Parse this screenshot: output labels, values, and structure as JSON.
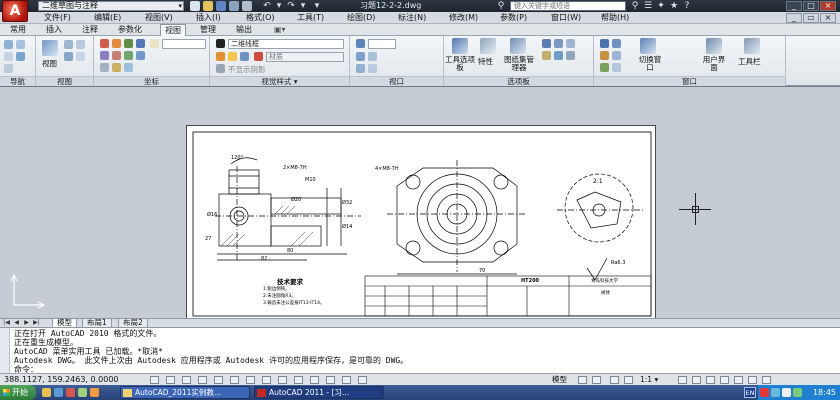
{
  "app": {
    "logo_letter": "A",
    "workspace": "二维草图与注释",
    "title": "习题12-2-2.dwg",
    "search_placeholder": "键入关键字或短语"
  },
  "menu": [
    "文件(F)",
    "编辑(E)",
    "视图(V)",
    "插入(I)",
    "格式(O)",
    "工具(T)",
    "绘图(D)",
    "标注(N)",
    "修改(M)",
    "参数(P)",
    "窗口(W)",
    "帮助(H)"
  ],
  "tabs": [
    "常用",
    "插入",
    "注释",
    "参数化",
    "视图",
    "管理",
    "输出"
  ],
  "active_tab": "视图",
  "ribbon": {
    "panels": [
      "导航",
      "视图",
      "坐标",
      "视觉样式",
      "视口",
      "选项板",
      "窗口"
    ],
    "view_button": "视图",
    "visual_style": "二维线框",
    "material_dd": "材质",
    "shadow_label": "不显示阴影",
    "palette_buttons": [
      "工具选项板",
      "特性",
      "图纸集管理器"
    ],
    "window_buttons": [
      "切换窗口",
      "用户界面",
      "工具栏"
    ]
  },
  "drawing": {
    "tech_req_title": "技术要求",
    "tech_req_items": [
      "1.锐边倒钝。",
      "2.未注圆角R3。",
      "3.铸造未注公差按IT13-IT14。"
    ],
    "title_block_name": "阀体",
    "school": "青岛科技大学",
    "part_code": "HT200",
    "scale_label": "2:1",
    "roughness_label": "Ra6.3",
    "dim_labels": [
      "120°",
      "2×M8-7H",
      "M10",
      "Ø20",
      "Ø32",
      "Ø14",
      "Ø16",
      "80",
      "82",
      "27",
      "4×M8-7H",
      "70"
    ]
  },
  "layout_tabs": [
    "模型",
    "布局1",
    "布局2"
  ],
  "active_layout": "模型",
  "command_lines": [
    "正在打开 AutoCAD 2010 格式的文件。",
    "正在重生成模型。",
    "AutoCAD 菜单实用工具 已加载。*取消*",
    "Autodesk DWG。  此文件上次由 Autodesk 应用程序或 Autodesk 许可的应用程序保存，是可靠的 DWG。",
    "命令："
  ],
  "status": {
    "coords": "388.1127, 159.2463, 0.0000",
    "model_label": "模型",
    "annotation_scale": "1:1"
  },
  "taskbar": {
    "start": "开始",
    "items": [
      "AutoCAD_2011实例教...",
      "AutoCAD 2011 - [习..."
    ],
    "lang": "EN",
    "clock": "18:45"
  }
}
